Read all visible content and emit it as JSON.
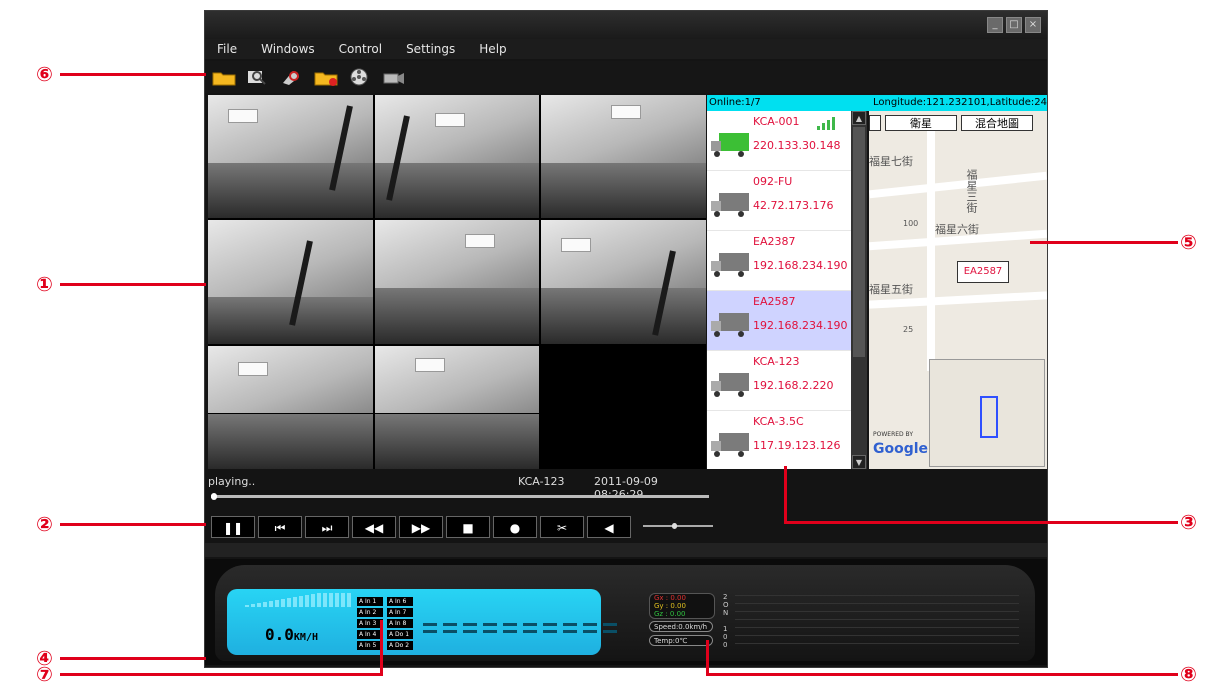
{
  "window": {
    "controls": [
      "_",
      "□",
      "×"
    ]
  },
  "menu": [
    "File",
    "Windows",
    "Control",
    "Settings",
    "Help"
  ],
  "toolbar": [
    "open-folder-icon",
    "search-icon",
    "find-icon",
    "delete-folder-icon",
    "reel-icon",
    "camera-icon"
  ],
  "header": {
    "online": "Online:1/7",
    "coordinates": "Longitude:121.232101,Latitude:24"
  },
  "vehicles": [
    {
      "name": "KCA-001",
      "ip": "220.133.30.148",
      "online": true
    },
    {
      "name": "092-FU",
      "ip": "42.72.173.176",
      "online": false
    },
    {
      "name": "EA2387",
      "ip": "192.168.234.190",
      "online": false
    },
    {
      "name": "EA2587",
      "ip": "192.168.234.190",
      "online": false
    },
    {
      "name": "KCA-123",
      "ip": "192.168.2.220",
      "online": false
    },
    {
      "name": "KCA-3.5C",
      "ip": "117.19.123.126",
      "online": false
    }
  ],
  "map": {
    "btn_satellite": "衛星",
    "btn_hybrid": "混合地圖",
    "labels": [
      "福星七街",
      "福星六街",
      "福星五街",
      "福星三街",
      "100",
      "25"
    ],
    "marker": "EA2587",
    "powered": "POWERED BY",
    "google": "Google"
  },
  "playback": {
    "status": "playing..",
    "vehicle": "KCA-123",
    "datetime": "2011-09-09 08:26:29",
    "progress": 0.0
  },
  "controls": [
    "❚❚",
    "⏮",
    "⏭",
    "◀◀",
    "▶▶",
    "■",
    "●",
    "✂",
    "◀"
  ],
  "volume_level": 0.45,
  "dashboard": {
    "speed_value": "0.0",
    "speed_unit": "KM/H",
    "alarm_tags": [
      "A In 1",
      "A In 6",
      "A In 2",
      "A In 7",
      "A In 3",
      "A In 8",
      "A In 4",
      "A Do 1",
      "A In 5",
      "A Do 2"
    ],
    "gx": "Gx : 0.00",
    "gy": "Gy : 0.00",
    "gz": "Gz : 0.00",
    "speed_pill": "Speed:0.0km/h",
    "temp_pill": "Temp:0℃",
    "axis_top": [
      "2",
      "O",
      "N"
    ],
    "axis_bottom": [
      "1",
      "0",
      "0"
    ]
  },
  "annotations": {
    "a1": "①",
    "a2": "②",
    "a3": "③",
    "a4": "④",
    "a5": "⑤",
    "a6": "⑥",
    "a7": "⑦",
    "a8": "⑧"
  },
  "colors": {
    "accent": "#00e0f0",
    "lcd": "#28d4f4",
    "annotation": "#e0001b",
    "vehicle_text": "#e0103c"
  }
}
